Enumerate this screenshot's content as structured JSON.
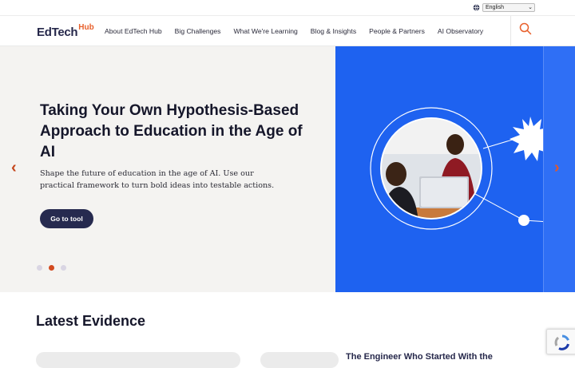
{
  "topbar": {
    "language": "English"
  },
  "header": {
    "logo_main": "EdTech",
    "logo_hub": "Hub",
    "nav": [
      {
        "label": "About EdTech Hub"
      },
      {
        "label": "Big Challenges"
      },
      {
        "label": "What We're Learning"
      },
      {
        "label": "Blog & Insights"
      },
      {
        "label": "People & Partners"
      },
      {
        "label": "AI Observatory"
      }
    ]
  },
  "hero": {
    "title": "Taking Your Own Hypothesis-Based Approach to Education in the Age of AI",
    "subtitle": "Shape the future of education in the age of AI. Use our practical framework to turn bold ideas into testable actions.",
    "cta_label": "Go to tool",
    "prev_arrow": "‹",
    "next_arrow": "›",
    "slides_total": 3,
    "slide_active": 2
  },
  "latest": {
    "title": "Latest Evidence",
    "card_title": "The Engineer Who Started With the"
  },
  "colors": {
    "brand_navy": "#262a4f",
    "brand_orange": "#e8602c",
    "hero_blue": "#1e62f0",
    "hero_bg": "#f4f3f1"
  }
}
